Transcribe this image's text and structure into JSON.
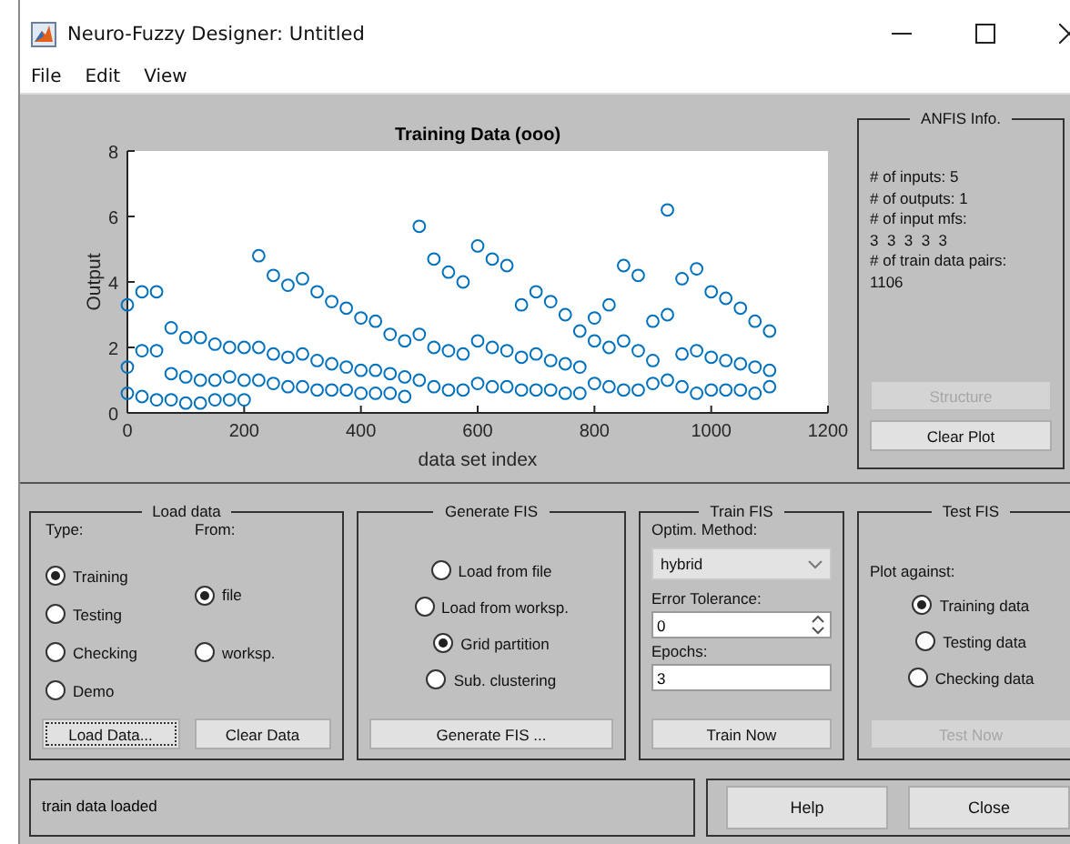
{
  "window": {
    "title": "Neuro-Fuzzy Designer: Untitled"
  },
  "menu": [
    "File",
    "Edit",
    "View"
  ],
  "plot": {
    "chart_data": {
      "type": "scatter",
      "title": "Training Data (ooo)",
      "xlabel": "data set index",
      "ylabel": "Output",
      "xlim": [
        0,
        1200
      ],
      "ylim": [
        0,
        8
      ],
      "xticks": [
        0,
        200,
        400,
        600,
        800,
        1000,
        1200
      ],
      "yticks": [
        0,
        2,
        4,
        6,
        8
      ],
      "x": [
        0,
        25,
        50,
        75,
        100,
        125,
        150,
        175,
        200,
        225,
        250,
        275,
        300,
        325,
        350,
        375,
        400,
        425,
        450,
        475,
        500,
        525,
        550,
        575,
        600,
        625,
        650,
        675,
        700,
        725,
        750,
        775,
        800,
        825,
        850,
        875,
        900,
        925,
        950,
        975,
        1000,
        1025,
        1050,
        1075,
        1100,
        0,
        25,
        50,
        75,
        100,
        125,
        150,
        175,
        200,
        225,
        250,
        275,
        300,
        325,
        350,
        375,
        400,
        425,
        450,
        475,
        500,
        525,
        550,
        575,
        600,
        625,
        650,
        675,
        700,
        725,
        750,
        775,
        800,
        825,
        850,
        875,
        900,
        925,
        950,
        975,
        1000,
        1025,
        1050,
        1075,
        1100,
        0,
        25,
        50,
        75,
        100,
        125,
        150,
        175,
        200,
        225,
        250,
        275,
        300,
        325,
        350,
        375,
        400,
        425,
        450,
        475,
        500,
        525,
        550,
        575,
        600,
        625,
        650,
        675,
        700,
        725,
        750,
        775,
        800,
        825,
        850,
        875,
        900,
        925,
        950,
        975,
        1000,
        1025,
        1050,
        1075,
        1100
      ],
      "series": [
        {
          "color": "#0072bd",
          "values": [
            3.3,
            3.7,
            3.7,
            2.6,
            2.3,
            2.3,
            2.1,
            2.0,
            2.0,
            4.8,
            4.2,
            3.9,
            4.1,
            3.7,
            3.4,
            3.2,
            2.9,
            2.8,
            2.4,
            2.2,
            5.7,
            4.7,
            4.3,
            4.0,
            5.1,
            4.7,
            4.5,
            3.3,
            3.7,
            3.4,
            3.0,
            2.5,
            2.9,
            3.3,
            4.5,
            4.2,
            2.8,
            6.2,
            4.1,
            4.4,
            3.7,
            3.5,
            3.2,
            2.8,
            2.5,
            1.4,
            1.9,
            1.9,
            1.2,
            1.1,
            1.0,
            1.0,
            1.1,
            1.0,
            2.0,
            1.8,
            1.7,
            1.8,
            1.6,
            1.5,
            1.4,
            1.3,
            1.3,
            1.2,
            1.1,
            2.4,
            2.0,
            1.9,
            1.8,
            2.2,
            2.0,
            1.9,
            1.7,
            1.8,
            1.6,
            1.5,
            1.4,
            2.2,
            2.0,
            2.2,
            1.9,
            1.6,
            3.0,
            1.8,
            1.9,
            1.7,
            1.6,
            1.5,
            1.4,
            1.3,
            0.6,
            0.5,
            0.4,
            0.4,
            0.3,
            0.3,
            0.4,
            0.4,
            0.4,
            1.0,
            0.9,
            0.8,
            0.8,
            0.7,
            0.7,
            0.7,
            0.6,
            0.6,
            0.6,
            0.5,
            1.0,
            0.8,
            0.7,
            0.7,
            0.9,
            0.8,
            0.8,
            0.7,
            0.7,
            0.7,
            0.6,
            0.6,
            0.9,
            0.8,
            0.7,
            0.7,
            0.9,
            1.0,
            0.8,
            0.6,
            0.7,
            0.7,
            0.7,
            0.6,
            0.8
          ]
        }
      ]
    }
  },
  "anfis_info": {
    "title": "ANFIS Info.",
    "lines": [
      "# of inputs: 5",
      "# of outputs: 1",
      "# of input mfs:",
      "3  3  3  3  3",
      "# of train data pairs:",
      "1106"
    ],
    "buttons": [
      {
        "label": "Structure",
        "disabled": true
      },
      {
        "label": "Clear Plot",
        "disabled": false
      }
    ]
  },
  "load_data": {
    "title": "Load data",
    "type_label": "Type:",
    "from_label": "From:",
    "types": [
      {
        "label": "Training",
        "selected": true
      },
      {
        "label": "Testing",
        "selected": false
      },
      {
        "label": "Checking",
        "selected": false
      },
      {
        "label": "Demo",
        "selected": false
      }
    ],
    "sources": [
      {
        "label": "file",
        "selected": true
      },
      {
        "label": "worksp.",
        "selected": false
      }
    ],
    "buttons": [
      {
        "label": "Load Data...",
        "focused": true
      },
      {
        "label": "Clear Data",
        "focused": false
      }
    ]
  },
  "generate_fis": {
    "title": "Generate FIS",
    "options": [
      {
        "label": "Load from file",
        "selected": false
      },
      {
        "label": "Load from worksp.",
        "selected": false
      },
      {
        "label": "Grid partition",
        "selected": true
      },
      {
        "label": "Sub. clustering",
        "selected": false
      }
    ],
    "button": "Generate FIS ..."
  },
  "train_fis": {
    "title": "Train FIS",
    "method_label": "Optim. Method:",
    "method": "hybrid",
    "tolerance_label": "Error Tolerance:",
    "tolerance": "0",
    "epochs_label": "Epochs:",
    "epochs": "3",
    "button": "Train Now"
  },
  "test_fis": {
    "title": "Test FIS",
    "plot_against_label": "Plot against:",
    "options": [
      {
        "label": "Training data",
        "selected": true
      },
      {
        "label": "Testing data",
        "selected": false
      },
      {
        "label": "Checking data",
        "selected": false
      }
    ],
    "button": {
      "label": "Test Now",
      "disabled": true
    }
  },
  "status": "train data loaded",
  "buttons": [
    "Help",
    "Close"
  ]
}
